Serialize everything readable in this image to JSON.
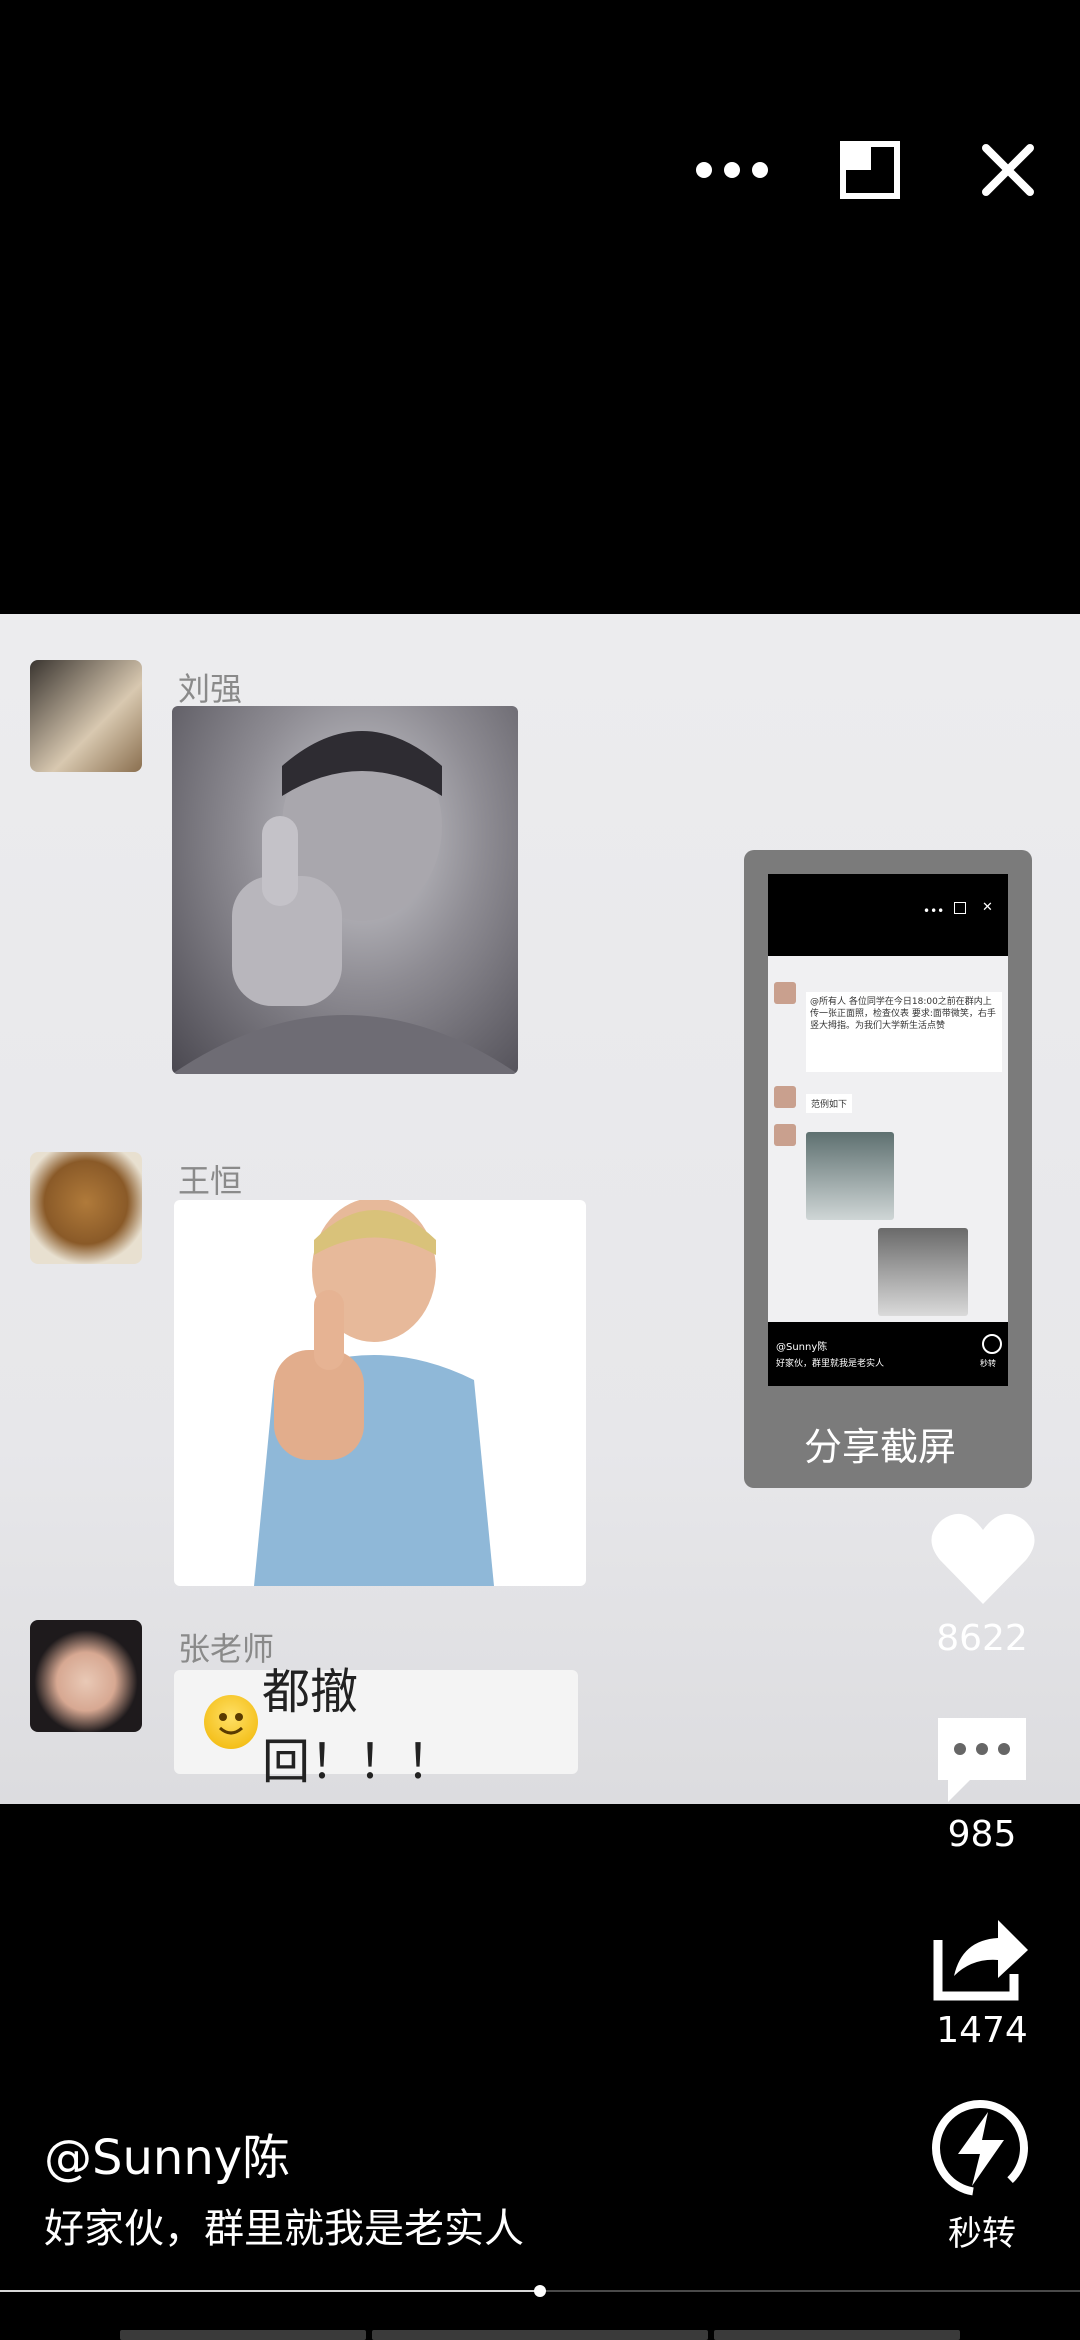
{
  "top_bar": {
    "more_icon": "more-dots-icon",
    "pip_icon": "window-icon",
    "close_icon": "close-icon"
  },
  "chat": {
    "messages": [
      {
        "sender": "刘强"
      },
      {
        "sender": "王恒"
      },
      {
        "sender": "张老师",
        "text": "都撤回！！！"
      }
    ]
  },
  "share_thumb": {
    "label": "分享截屏",
    "inner_author": "@Sunny陈",
    "inner_caption": "好家伙，群里就我是老实人",
    "inner_msg_1": "@所有人 各位同学在今日18:00之前在群内上传一张正面照，检查仪表 要求:面带微笑，右手竖大拇指。为我们大学新生活点赞",
    "inner_msg_2": "范例如下",
    "inner_badge": "秒转"
  },
  "actions": {
    "likes": "8622",
    "comments": "985",
    "shares": "1474",
    "quick_label": "秒转"
  },
  "post": {
    "author": "@Sunny陈",
    "caption": "好家伙，群里就我是老实人"
  },
  "progress": {
    "fraction": 0.5
  }
}
